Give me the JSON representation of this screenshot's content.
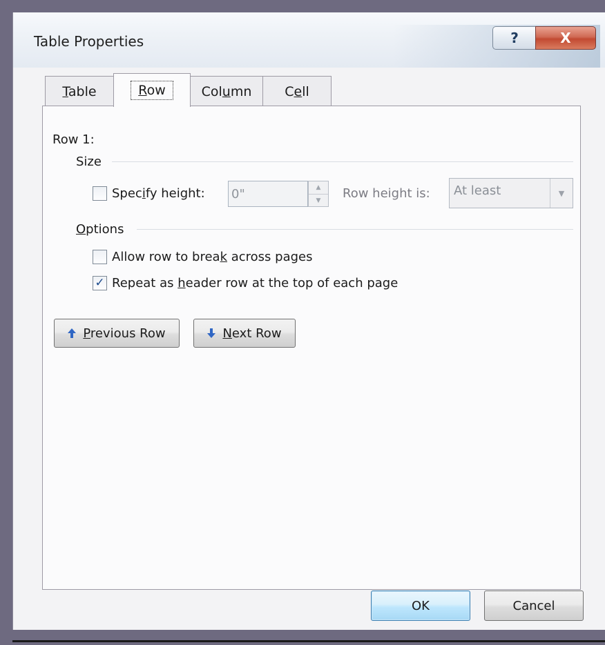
{
  "window": {
    "title": "Table Properties",
    "help_glyph": "?",
    "close_glyph": "X"
  },
  "tabs": [
    {
      "label_pre": "",
      "label_u": "T",
      "label_post": "able"
    },
    {
      "label_pre": "",
      "label_u": "R",
      "label_post": "ow"
    },
    {
      "label_pre": "Col",
      "label_u": "u",
      "label_post": "mn"
    },
    {
      "label_pre": "C",
      "label_u": "e",
      "label_post": "ll"
    }
  ],
  "row_panel": {
    "row_title": "Row 1:",
    "size_section": "Size",
    "specify_height_pre": "Spec",
    "specify_height_u": "i",
    "specify_height_post": "fy height:",
    "specify_height_checked": false,
    "height_value": "0\"",
    "row_height_is_label": "Row height is:",
    "row_height_mode": "At least",
    "options_section_u": "O",
    "options_section_post": "ptions",
    "allow_break_pre": "Allow row to brea",
    "allow_break_u": "k",
    "allow_break_post": " across pages",
    "allow_break_checked": false,
    "repeat_header_pre": "Repeat as ",
    "repeat_header_u": "h",
    "repeat_header_post": "eader row at the top of each page",
    "repeat_header_checked": true,
    "previous_row_u": "P",
    "previous_row_post": "revious Row",
    "next_row_u": "N",
    "next_row_post": "ext Row"
  },
  "footer": {
    "ok_label": "OK",
    "cancel_label": "Cancel"
  },
  "colors": {
    "arrow_blue": "#2f66c4",
    "check_blue": "#1c4a8c"
  }
}
